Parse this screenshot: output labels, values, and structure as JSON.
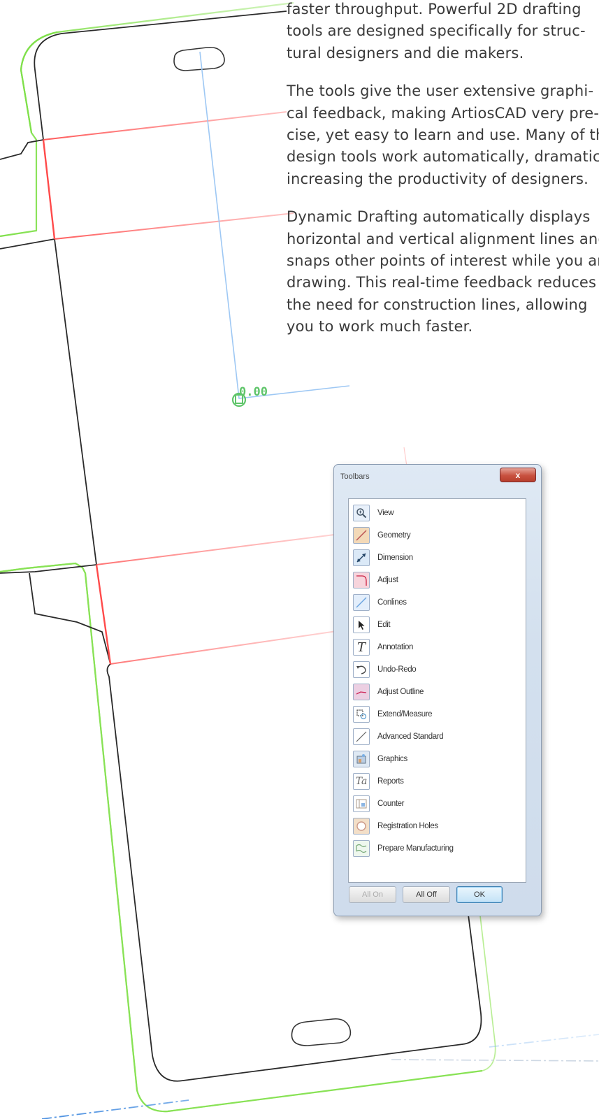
{
  "drawing": {
    "dimension_value": "0.00"
  },
  "text": {
    "paragraphs": [
      [
        "faster throughput. Powerful 2D drafting",
        "tools are designed specifically for struc-",
        "tural designers and die makers."
      ],
      [
        "The tools give the user extensive graphi-",
        "cal feedback, making ArtiosCAD very pre-",
        "cise, yet easy to learn and use. Many of the",
        "design tools work automatically, dramatically",
        "increasing the productivity of designers."
      ],
      [
        "Dynamic Drafting automatically displays",
        "horizontal and vertical alignment lines and",
        "snaps other points of interest while you are",
        "drawing. This real-time feedback reduces",
        "the need for construction lines, allowing",
        "you to work much faster."
      ]
    ]
  },
  "dialog": {
    "title": "Toolbars",
    "close_label": "x",
    "tools": [
      {
        "label": "View",
        "icon": "magnifier-icon"
      },
      {
        "label": "Geometry",
        "icon": "geometry-icon"
      },
      {
        "label": "Dimension",
        "icon": "dimension-icon"
      },
      {
        "label": "Adjust",
        "icon": "adjust-icon"
      },
      {
        "label": "Conlines",
        "icon": "conlines-icon"
      },
      {
        "label": "Edit",
        "icon": "cursor-arrow-icon"
      },
      {
        "label": "Annotation",
        "icon": "text-t-icon"
      },
      {
        "label": "Undo-Redo",
        "icon": "undo-icon"
      },
      {
        "label": "Adjust Outline",
        "icon": "adjust-outline-icon"
      },
      {
        "label": "Extend/Measure",
        "icon": "extend-measure-icon"
      },
      {
        "label": "Advanced Standard",
        "icon": "advanced-standard-icon"
      },
      {
        "label": "Graphics",
        "icon": "graphics-icon"
      },
      {
        "label": "Reports",
        "icon": "reports-icon"
      },
      {
        "label": "Counter",
        "icon": "counter-icon"
      },
      {
        "label": "Registration Holes",
        "icon": "registration-hole-icon"
      },
      {
        "label": "Prepare Manufacturing",
        "icon": "prepare-manufacturing-icon"
      }
    ],
    "buttons": {
      "all_on": "All On",
      "all_off": "All Off",
      "ok": "OK"
    }
  }
}
